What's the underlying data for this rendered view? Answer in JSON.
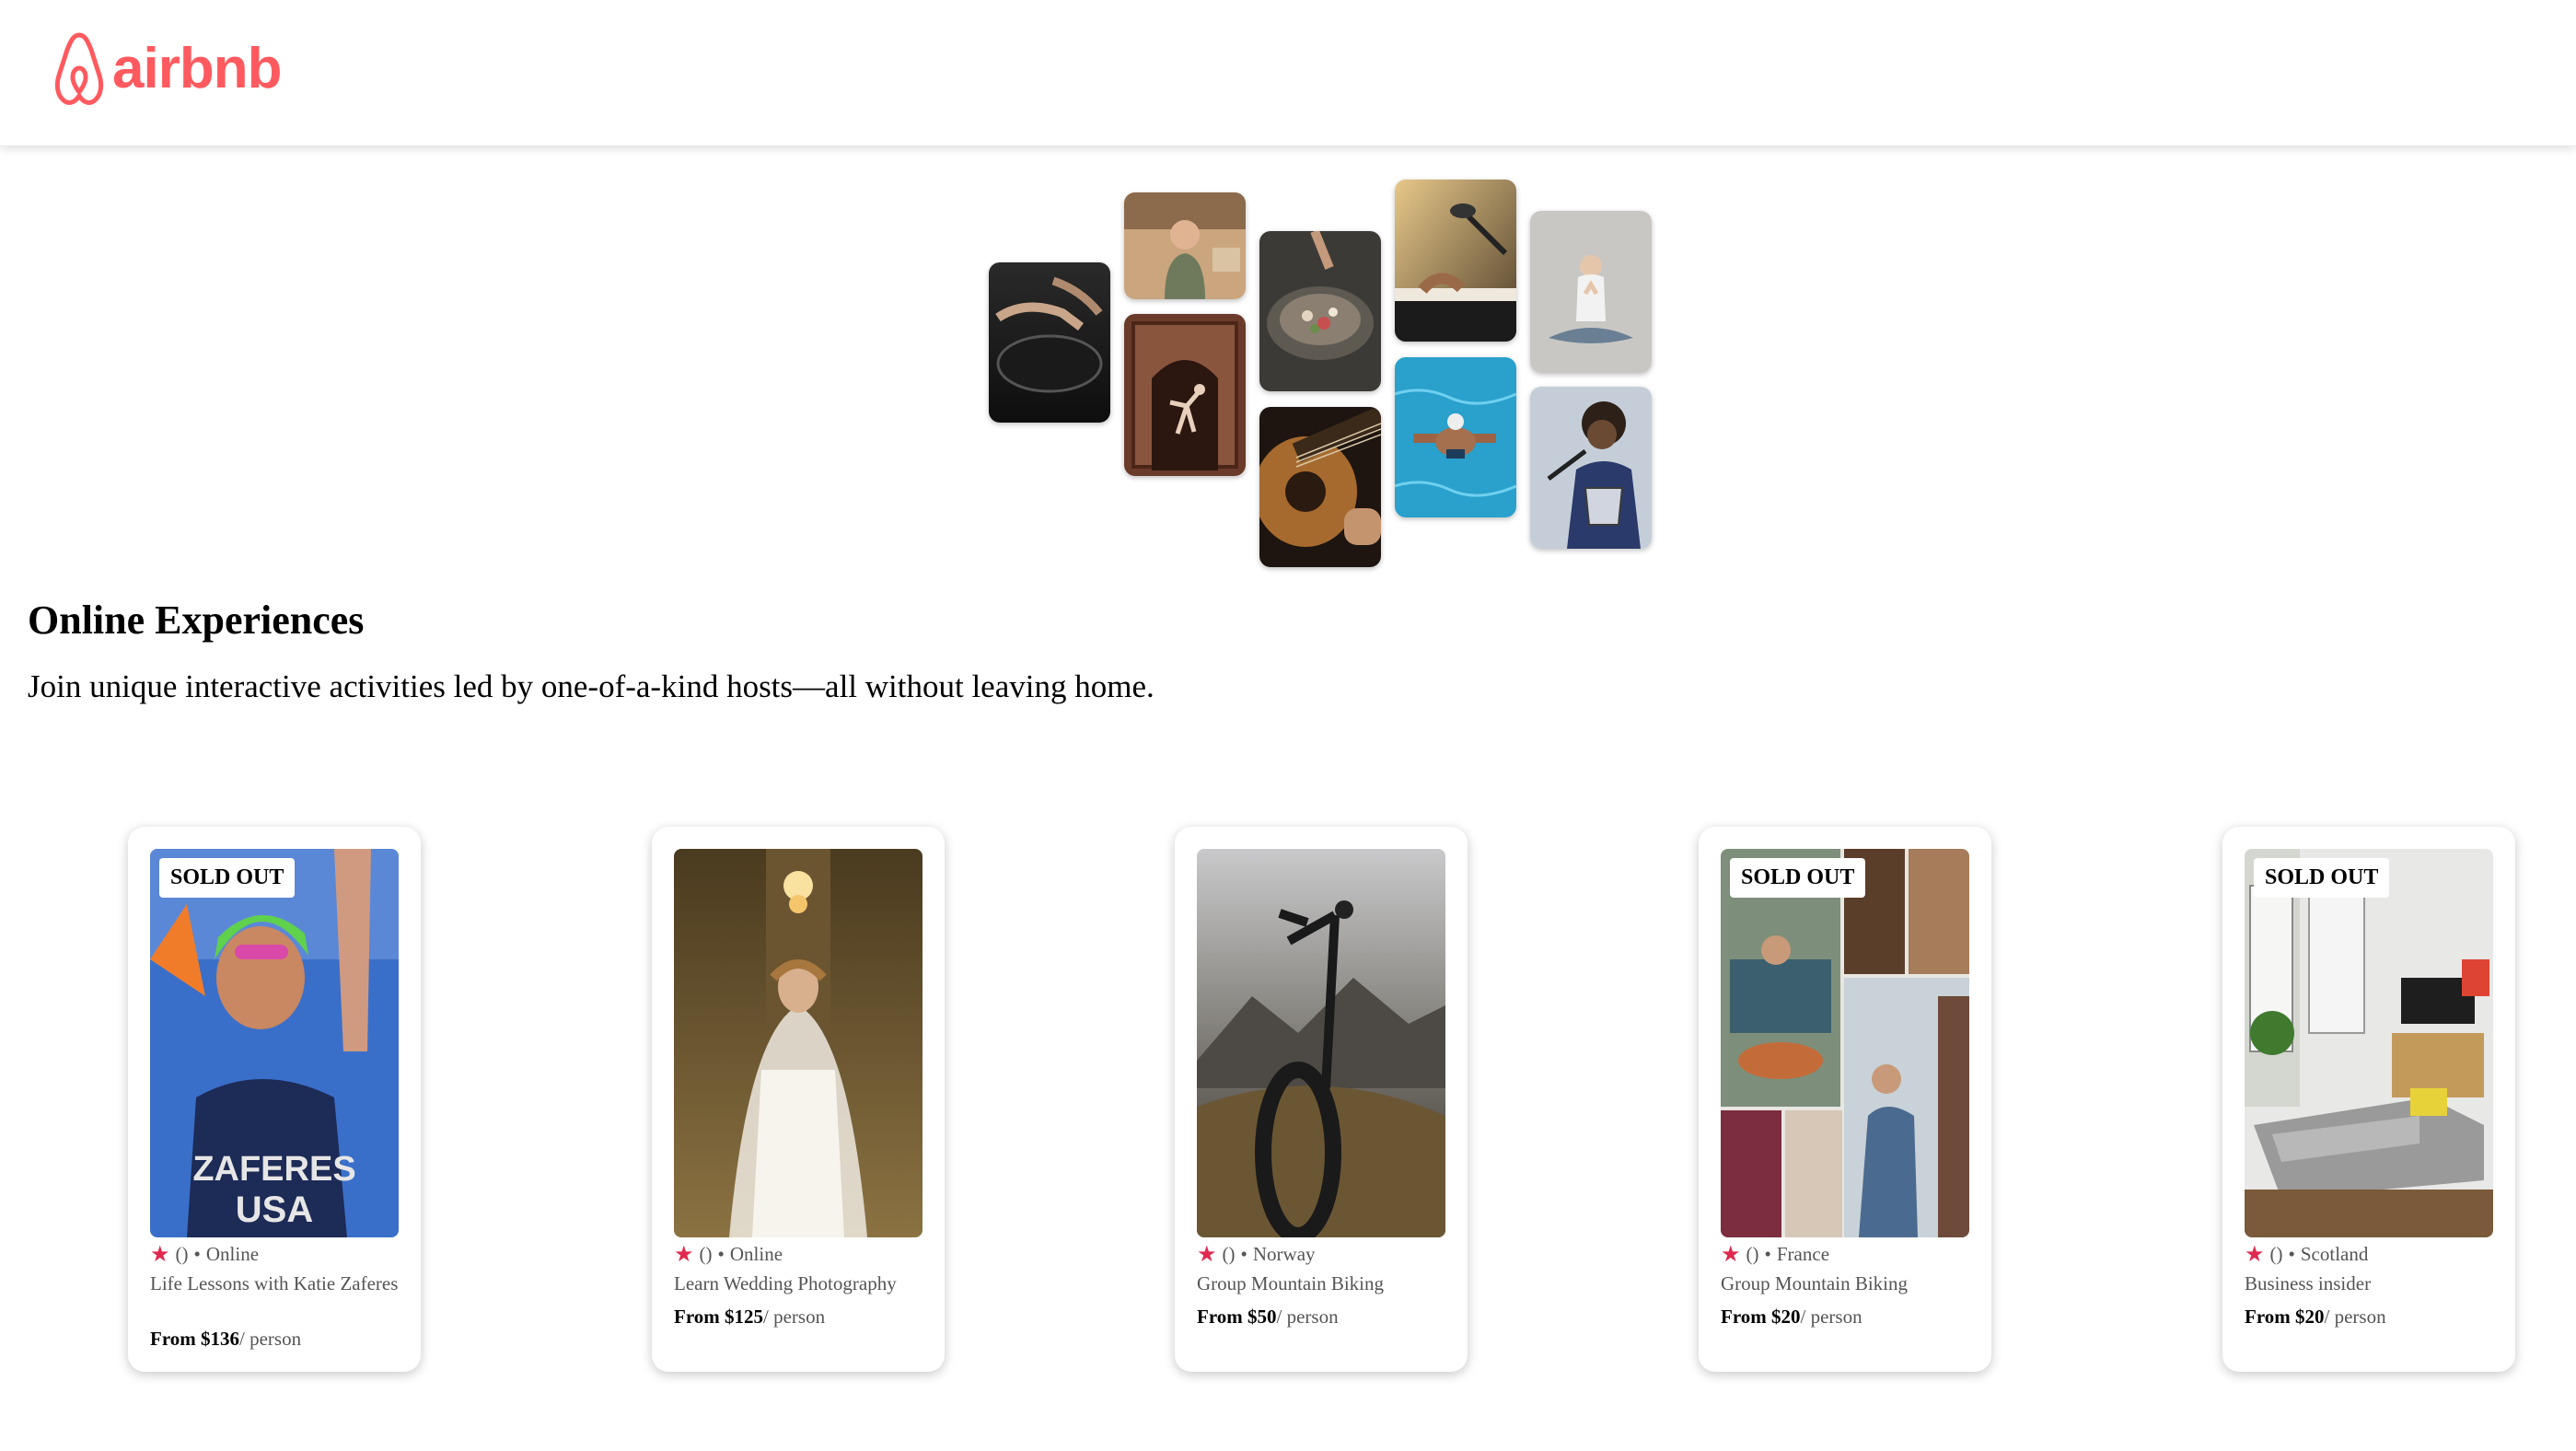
{
  "brand": {
    "name": "airbnb",
    "color": "#FF5A5F"
  },
  "hero": {
    "heading": "Online Experiences",
    "subheading": "Join unique interactive activities led by one-of-a-kind hosts—all without leaving home.",
    "photos": [
      "cooking-pan-photo",
      "woman-cooking-photo",
      "dancer-doorway-photo",
      "food-bowl-photo",
      "guitar-photo",
      "microphone-piano-photo",
      "swimmer-pool-photo",
      "yoga-woman-photo",
      "singer-photo"
    ]
  },
  "cards": [
    {
      "sold_out": "SOLD OUT",
      "rating": "()",
      "location": "Online",
      "title": "Life Lessons with Katie Zaferes",
      "price_prefix": "From $136",
      "price_suffix": "/ person"
    },
    {
      "sold_out": "",
      "rating": "()",
      "location": "Online",
      "title": "Learn Wedding Photography",
      "price_prefix": "From $125",
      "price_suffix": "/ person"
    },
    {
      "sold_out": "",
      "rating": "()",
      "location": "Norway",
      "title": "Group Mountain Biking",
      "price_prefix": "From $50",
      "price_suffix": "/ person"
    },
    {
      "sold_out": "SOLD OUT",
      "rating": "()",
      "location": "France",
      "title": "Group Mountain Biking",
      "price_prefix": "From $20",
      "price_suffix": "/ person"
    },
    {
      "sold_out": "SOLD OUT",
      "rating": "()",
      "location": "Scotland",
      "title": "Business insider",
      "price_prefix": "From $20",
      "price_suffix": "/ person"
    }
  ]
}
